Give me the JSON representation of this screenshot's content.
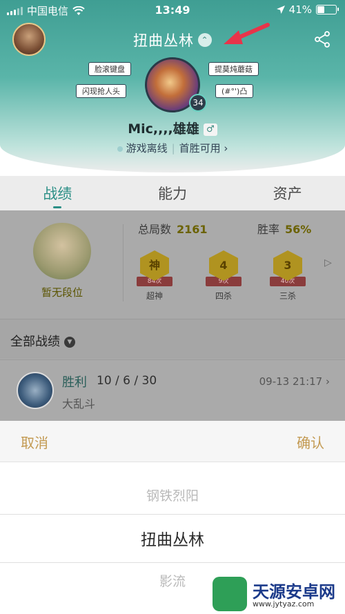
{
  "status_bar": {
    "carrier": "中国电信",
    "time": "13:49",
    "battery": "41%",
    "battery_level": 0.41
  },
  "header": {
    "title": "扭曲丛林",
    "username": "Mic,,,,雄雄",
    "level": "34",
    "status": "游戏离线",
    "first_win": "首胜可用",
    "tags": [
      "脸滚键盘",
      "闪现抢人头",
      "提莫炖蘑菇",
      "(#°')凸"
    ]
  },
  "tabs": [
    "战绩",
    "能力",
    "资产"
  ],
  "summary": {
    "rank_label": "暂无段位",
    "total_label": "总局数",
    "total_value": "2161",
    "winrate_label": "胜率",
    "winrate_value": "56%",
    "badges": [
      {
        "glyph": "神",
        "count": "84次",
        "name": "超神"
      },
      {
        "glyph": "4",
        "count": "9次",
        "name": "四杀"
      },
      {
        "glyph": "3",
        "count": "40次",
        "name": "三杀"
      }
    ]
  },
  "filter": {
    "label": "全部战绩"
  },
  "record": {
    "result": "胜利",
    "kda": "10 / 6 / 30",
    "mode": "大乱斗",
    "date": "09-13 21:17"
  },
  "picker": {
    "cancel": "取消",
    "confirm": "确认",
    "options": [
      "钢铁烈阳",
      "扭曲丛林",
      "影流"
    ]
  },
  "watermark": {
    "name": "天源安卓网",
    "url": "www.jytyaz.com"
  },
  "colors": {
    "accent": "#2b8f86",
    "picker_action": "#c39a52",
    "arrow": "#e8344a"
  }
}
